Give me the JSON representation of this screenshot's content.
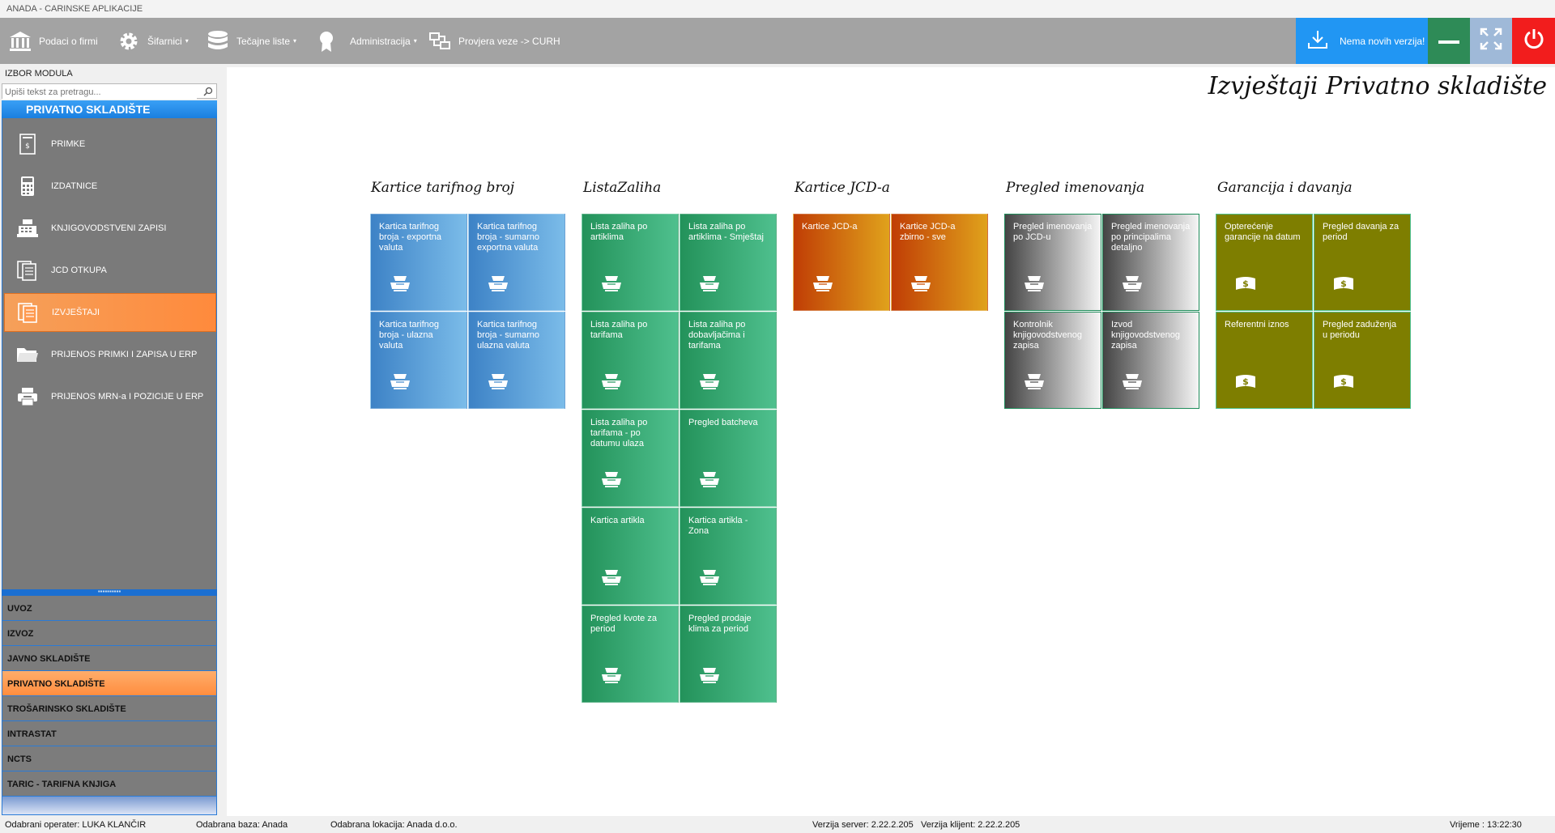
{
  "window": {
    "title": "ANADA - CARINSKE APLIKACIJE"
  },
  "toolbar": {
    "items": [
      {
        "label": "Podaci o firmi",
        "icon": "bank-icon"
      },
      {
        "label": "Šifarnici",
        "icon": "gear-icon",
        "dropdown": true
      },
      {
        "label": "Tečajne liste",
        "icon": "database-icon",
        "dropdown": true
      },
      {
        "label": "Administracija",
        "icon": "award-icon",
        "dropdown": true
      },
      {
        "label": "Provjera veze -> CURH",
        "icon": "network-icon"
      }
    ],
    "update_label": "Nema novih verzija!",
    "dropdown_arrow": "▾"
  },
  "sidebar": {
    "header": "IZBOR MODULA",
    "search_placeholder": "Upiši tekst za pretragu...",
    "module_title": "PRIVATNO SKLADIŠTE",
    "items": [
      {
        "label": "PRIMKE",
        "icon": "receipt-icon"
      },
      {
        "label": "IZDATNICE",
        "icon": "calculator-icon"
      },
      {
        "label": "KNJIGOVODSTVENI ZAPISI",
        "icon": "cash-register-icon"
      },
      {
        "label": "JCD OTKUPA",
        "icon": "documents-icon"
      },
      {
        "label": "IZVJEŠTAJI",
        "icon": "report-icon",
        "active": true
      },
      {
        "label": "PRIJENOS PRIMKI I ZAPISA U ERP",
        "icon": "folder-icon"
      },
      {
        "label": "PRIJENOS MRN-a I POZICIJE U ERP",
        "icon": "printer-icon"
      }
    ],
    "grip": "▪▪▪▪▪▪▪▪▪▪",
    "modules": [
      {
        "label": "UVOZ"
      },
      {
        "label": "IZVOZ"
      },
      {
        "label": "JAVNO SKLADIŠTE"
      },
      {
        "label": "PRIVATNO SKLADIŠTE",
        "active": true
      },
      {
        "label": "TROŠARINSKO SKLADIŠTE"
      },
      {
        "label": "INTRASTAT"
      },
      {
        "label": "NCTS"
      },
      {
        "label": "TARIC - TARIFNA KNJIGA"
      }
    ]
  },
  "main": {
    "title": "Izvještaji Privatno skladište",
    "groups": [
      {
        "title": "Kartice tarifnog broj",
        "style": "blue",
        "tiles": [
          {
            "label": "Kartica tarifnog broja - exportna valuta",
            "icon": "report-print-icon"
          },
          {
            "label": "Kartica tarifnog broja - sumarno exportna valuta",
            "icon": "report-print-icon"
          },
          {
            "label": "Kartica tarifnog broja - ulazna valuta",
            "icon": "report-print-icon"
          },
          {
            "label": "Kartica tarifnog broja - sumarno ulazna valuta",
            "icon": "report-print-icon"
          }
        ]
      },
      {
        "title": "ListaZaliha",
        "style": "green",
        "tiles": [
          {
            "label": "Lista zaliha po artiklima",
            "icon": "report-print-icon"
          },
          {
            "label": "Lista zaliha po artiklima - Smještaj",
            "icon": "report-print-icon"
          },
          {
            "label": "Lista zaliha po tarifama",
            "icon": "report-print-icon"
          },
          {
            "label": "Lista zaliha po dobavljačima i tarifama",
            "icon": "report-print-icon"
          },
          {
            "label": "Lista zaliha po tarifama - po datumu ulaza",
            "icon": "report-print-icon"
          },
          {
            "label": "Pregled batcheva",
            "icon": "report-print-icon"
          },
          {
            "label": "Kartica artikla",
            "icon": "report-print-icon"
          },
          {
            "label": "Kartica artikla - Zona",
            "icon": "report-print-icon"
          },
          {
            "label": "Pregled kvote za period",
            "icon": "report-print-icon"
          },
          {
            "label": "Pregled prodaje klima za period",
            "icon": "report-print-icon"
          }
        ]
      },
      {
        "title": "Kartice JCD-a",
        "style": "orange",
        "tiles": [
          {
            "label": "Kartice JCD-a",
            "icon": "report-print-icon"
          },
          {
            "label": "Kartice JCD-a zbirno - sve",
            "icon": "report-print-icon"
          }
        ]
      },
      {
        "title": "Pregled imenovanja",
        "style": "gray",
        "tiles": [
          {
            "label": "Pregled imenovanja po JCD-u",
            "icon": "report-print-icon"
          },
          {
            "label": "Pregled imenovanja po principalima detaljno",
            "icon": "report-print-icon"
          },
          {
            "label": "Kontrolnik knjigovodstvenog zapisa",
            "icon": "report-print-icon"
          },
          {
            "label": "Izvod knjigovodstvenog zapisa",
            "icon": "report-print-icon"
          }
        ]
      },
      {
        "title": "Garancija i davanja",
        "style": "olive",
        "tiles": [
          {
            "label": "Opterećenje garancije na datum",
            "icon": "money-icon"
          },
          {
            "label": "Pregled davanja za period",
            "icon": "money-icon"
          },
          {
            "label": "Referentni iznos",
            "icon": "money-icon"
          },
          {
            "label": "Pregled zaduženja u periodu",
            "icon": "money-icon"
          }
        ]
      }
    ]
  },
  "status": {
    "operator": "Odabrani operater: LUKA KLANČIR",
    "database": "Odabrana baza: Anada",
    "location": "Odabrana lokacija: Anada d.o.o.",
    "server_version": "Verzija server: 2.22.2.205",
    "client_version": "Verzija klijent: 2.22.2.205",
    "time": "Vrijeme : 13:22:30"
  },
  "colors": {
    "toolbar": "#a3a3a3",
    "update": "#2196f3",
    "minimize": "#2e8b57",
    "maximize": "#9fb9d8",
    "power": "#f21d1d",
    "active": "#ff8d3f",
    "sidebar_panel": "#7a7a7a"
  }
}
